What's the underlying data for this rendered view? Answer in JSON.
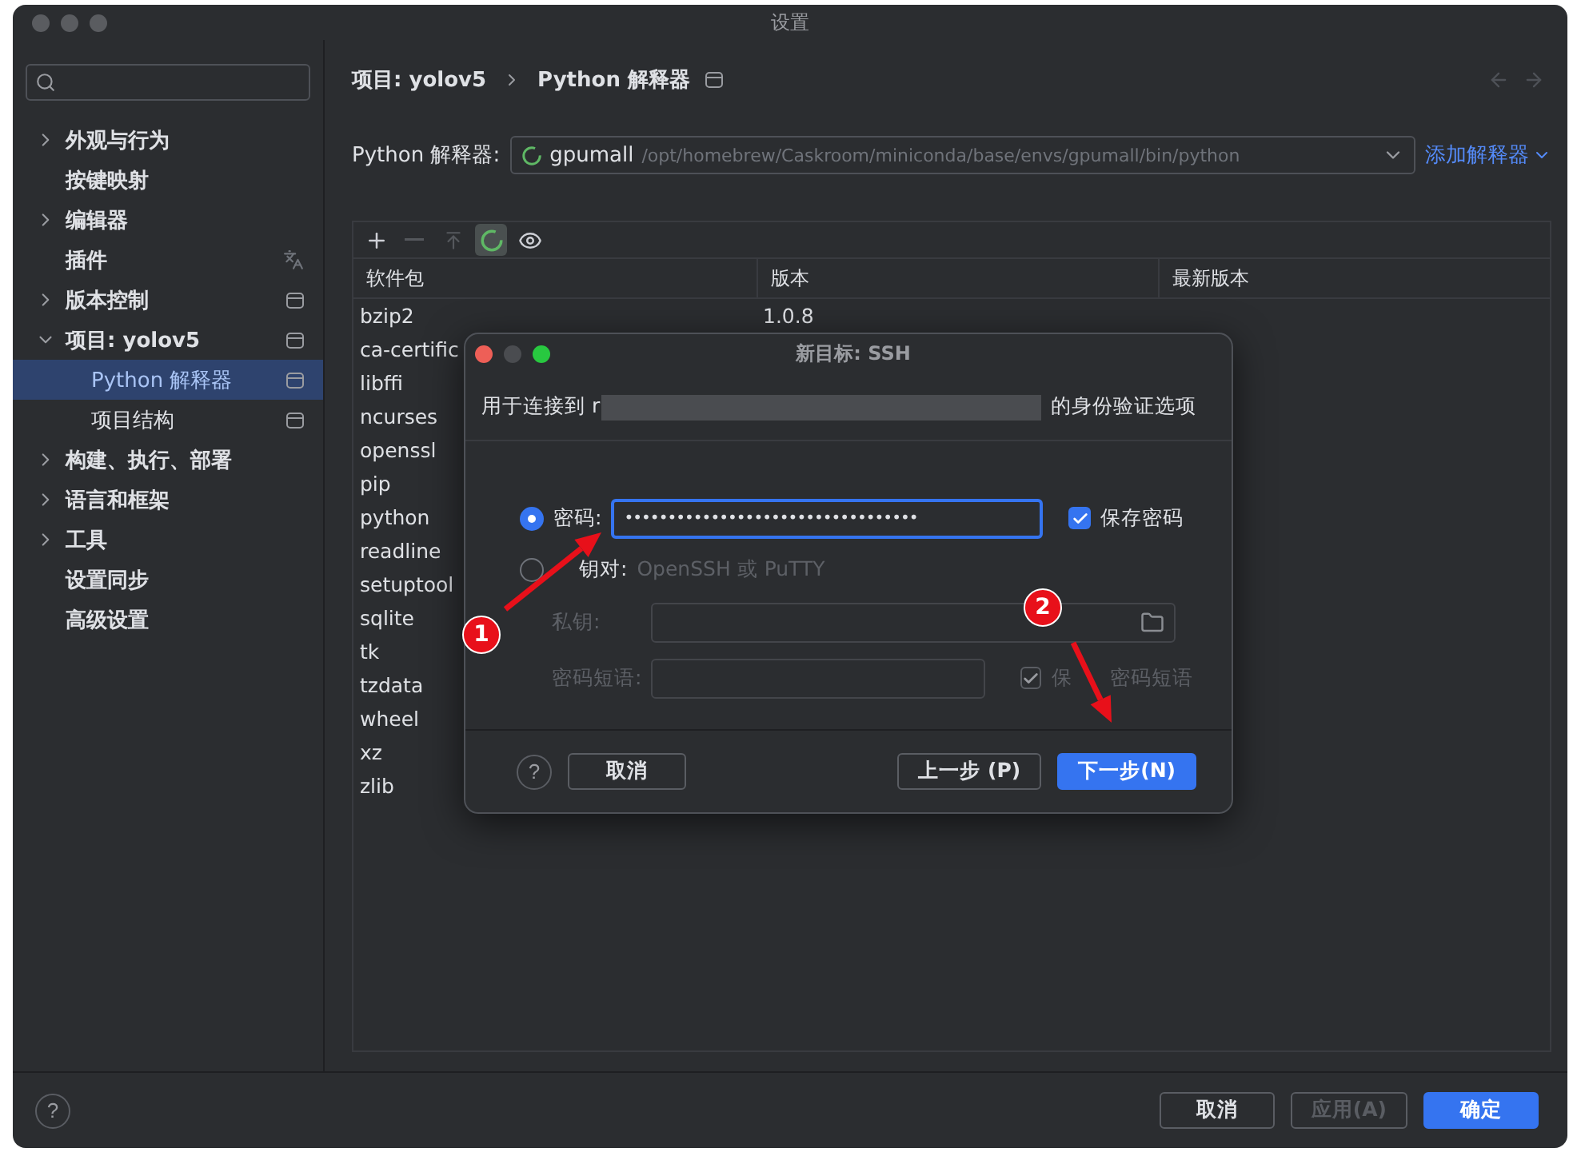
{
  "window": {
    "title": "设置"
  },
  "sidebar": {
    "items": [
      {
        "label": "外观与行为",
        "expanded": false
      },
      {
        "label": "按键映射"
      },
      {
        "label": "编辑器",
        "expanded": false
      },
      {
        "label": "插件",
        "language_icon": true
      },
      {
        "label": "版本控制",
        "expanded": false,
        "scope_icon": true
      },
      {
        "label": "项目: yolov5",
        "expanded": true,
        "scope_icon": true,
        "children": [
          {
            "label": "Python 解释器",
            "selected": true,
            "scope_icon": true
          },
          {
            "label": "项目结构",
            "selected": false,
            "scope_icon": true
          }
        ]
      },
      {
        "label": "构建、执行、部署",
        "expanded": false
      },
      {
        "label": "语言和框架",
        "expanded": false
      },
      {
        "label": "工具",
        "expanded": false
      },
      {
        "label": "设置同步"
      },
      {
        "label": "高级设置"
      }
    ]
  },
  "breadcrumb": [
    "项目: yolov5",
    "Python 解释器"
  ],
  "nav": {
    "back_disabled": true,
    "forward_disabled": true
  },
  "interpreter": {
    "label": "Python 解释器:",
    "name": "gpumall",
    "path": "/opt/homebrew/Caskroom/miniconda/base/envs/gpumall/bin/python",
    "add_link": "添加解释器"
  },
  "toolbar": [
    {
      "kind": "add",
      "disabled": false,
      "pressed": false
    },
    {
      "kind": "remove",
      "disabled": true,
      "pressed": false
    },
    {
      "kind": "upgrade",
      "disabled": true,
      "pressed": false
    },
    {
      "kind": "conda",
      "disabled": false,
      "pressed": true
    },
    {
      "kind": "show",
      "disabled": false,
      "pressed": false
    }
  ],
  "table": {
    "columns": [
      "软件包",
      "版本",
      "最新版本"
    ],
    "rows": [
      {
        "package": "bzip2",
        "version": "1.0.8"
      },
      {
        "package": "ca-certific"
      },
      {
        "package": "libffi"
      },
      {
        "package": "ncurses"
      },
      {
        "package": "openssl"
      },
      {
        "package": "pip"
      },
      {
        "package": "python"
      },
      {
        "package": "readline"
      },
      {
        "package": "setuptool"
      },
      {
        "package": "sqlite"
      },
      {
        "package": "tk"
      },
      {
        "package": "tzdata"
      },
      {
        "package": "wheel"
      },
      {
        "package": "xz"
      },
      {
        "package": "zlib"
      }
    ]
  },
  "dialog": {
    "title": "新目标: SSH",
    "description_start": "用于连接到 r",
    "redacted": true,
    "description_end": "的身份验证选项",
    "options": [
      {
        "label": "密码:",
        "selected": true,
        "value": "••••••••••••••••••••••••••••••••••",
        "save_label": "保存密码",
        "save_checked": true
      },
      {
        "label": "钥对:",
        "selected": false,
        "hint": "OpenSSH 或 PuTTY",
        "key_label": "私钥:",
        "phrase_label": "密码短语:",
        "save_label_start": "保",
        "save_label_end": "密码短语",
        "save_checked": true
      }
    ],
    "help": "?",
    "buttons": [
      {
        "label": "取消",
        "kind": "plain"
      },
      {
        "label": "上一步 (P)",
        "kind": "plain"
      },
      {
        "label": "下一步(N)",
        "kind": "primary"
      }
    ]
  },
  "footer": {
    "help": "?",
    "buttons": [
      {
        "label": "取消",
        "kind": "plain",
        "disabled": false
      },
      {
        "label": "应用(A)",
        "kind": "plain",
        "disabled": true
      },
      {
        "label": "确定",
        "kind": "primary",
        "disabled": false
      }
    ]
  },
  "annotations": [
    {
      "label": "1"
    },
    {
      "label": "2"
    }
  ]
}
